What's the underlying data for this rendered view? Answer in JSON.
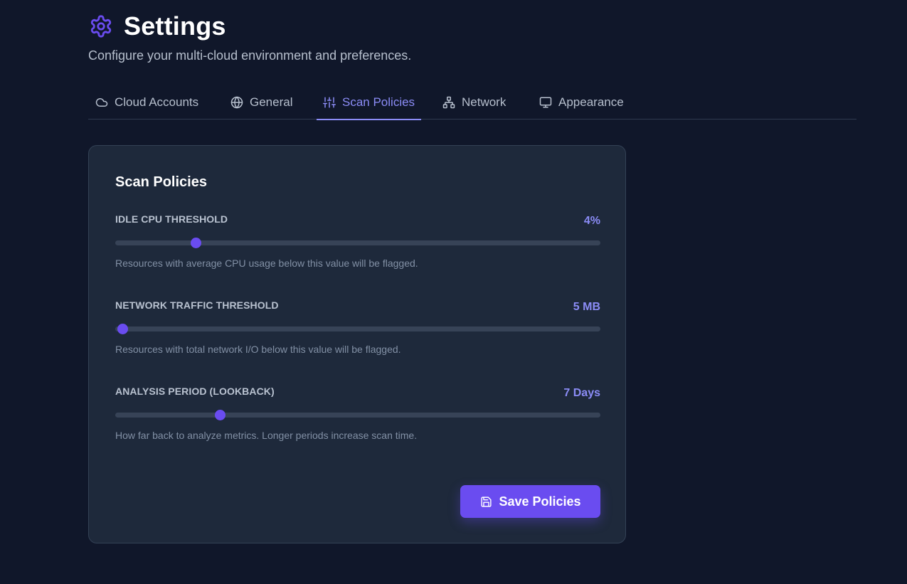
{
  "header": {
    "title": "Settings",
    "subtitle": "Configure your multi-cloud environment and preferences.",
    "icon": "gear-icon"
  },
  "tabs": [
    {
      "label": "Cloud Accounts",
      "icon": "cloud-icon",
      "active": false
    },
    {
      "label": "General",
      "icon": "globe-icon",
      "active": false
    },
    {
      "label": "Scan Policies",
      "icon": "sliders-icon",
      "active": true
    },
    {
      "label": "Network",
      "icon": "network-icon",
      "active": false
    },
    {
      "label": "Appearance",
      "icon": "monitor-icon",
      "active": false
    }
  ],
  "card": {
    "title": "Scan Policies",
    "settings": [
      {
        "label": "IDLE CPU THRESHOLD",
        "value": "4%",
        "slider_fraction": 0.165,
        "help": "Resources with average CPU usage below this value will be flagged."
      },
      {
        "label": "NETWORK TRAFFIC THRESHOLD",
        "value": "5 MB",
        "slider_fraction": 0.015,
        "help": "Resources with total network I/O below this value will be flagged."
      },
      {
        "label": "ANALYSIS PERIOD (LOOKBACK)",
        "value": "7 Days",
        "slider_fraction": 0.215,
        "help": "How far back to analyze metrics. Longer periods increase scan time."
      }
    ],
    "save_label": "Save Policies",
    "save_icon": "save-icon"
  },
  "colors": {
    "accent": "#8b8cf6",
    "button": "#6a4cf0",
    "background": "#10172a",
    "card": "#1e293b"
  }
}
